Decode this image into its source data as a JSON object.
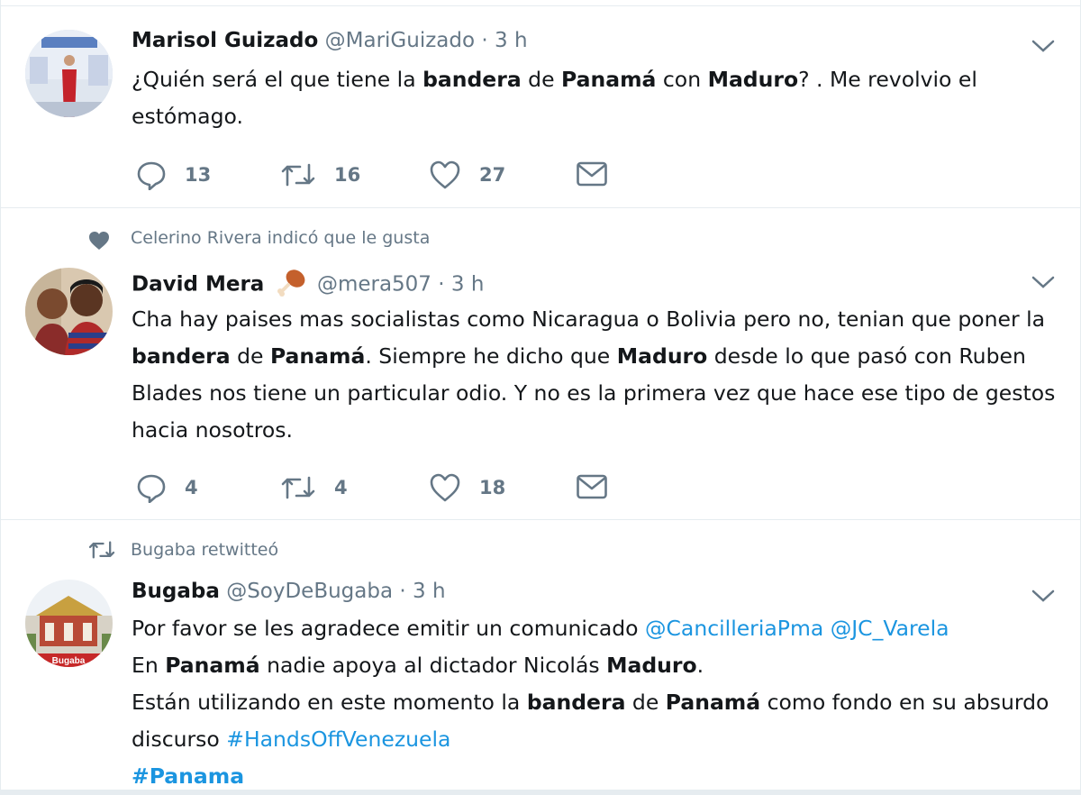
{
  "tweets": [
    {
      "name": "Marisol Guizado",
      "handle": "@MariGuizado",
      "time": "3 h",
      "text": [
        {
          "t": "¿Quién será el que tiene la "
        },
        {
          "b": "bandera"
        },
        {
          "t": " de "
        },
        {
          "b": "Panamá"
        },
        {
          "t": " con "
        },
        {
          "b": "Maduro"
        },
        {
          "t": "? . Me revolvio el estómago."
        }
      ],
      "replies": "13",
      "retweets": "16",
      "likes": "27"
    },
    {
      "context": "Celerino Rivera indicó que le gusta",
      "name": "David Mera",
      "handle": "@mera507",
      "time": "3 h",
      "text": [
        {
          "t": "Cha hay paises mas socialistas como Nicaragua o Bolivia pero no, tenian que poner la "
        },
        {
          "b": "bandera"
        },
        {
          "t": " de "
        },
        {
          "b": "Panamá"
        },
        {
          "t": ". Siempre he dicho que "
        },
        {
          "b": "Maduro"
        },
        {
          "t": " desde lo que pasó con Ruben Blades nos tiene un particular odio. Y no es la primera vez que hace ese tipo de gestos hacia nosotros."
        }
      ],
      "replies": "4",
      "retweets": "4",
      "likes": "18"
    },
    {
      "context": "Bugaba retwitteó",
      "name": "Bugaba",
      "handle": "@SoyDeBugaba",
      "time": "3 h",
      "avatar_text": "Bugaba",
      "text": [
        {
          "t": "Por favor se les agradece emitir un comunicado "
        },
        {
          "l": "@CancilleriaPma"
        },
        {
          "t": " "
        },
        {
          "l": "@JC_Varela"
        },
        {
          "br": true
        },
        {
          "t": "En "
        },
        {
          "b": "Panamá"
        },
        {
          "t": " nadie apoya al dictador Nicolás "
        },
        {
          "b": "Maduro"
        },
        {
          "t": "."
        },
        {
          "br": true
        },
        {
          "t": "Están utilizando en este momento la "
        },
        {
          "b": "bandera"
        },
        {
          "t": " de "
        },
        {
          "b": "Panamá"
        },
        {
          "t": " como fondo en su absurdo discurso  "
        },
        {
          "l": "#HandsOffVenezuela"
        },
        {
          "br": true
        },
        {
          "lb": "#Panama"
        }
      ]
    }
  ],
  "icons": {
    "reply": "reply-icon",
    "retweet": "retweet-icon",
    "like": "heart-icon",
    "dm": "envelope-icon",
    "caret": "chevron-down-icon"
  },
  "colors": {
    "muted": "#657786",
    "link": "#1b95e0",
    "text": "#14171a",
    "divider": "#e6ecf0"
  }
}
